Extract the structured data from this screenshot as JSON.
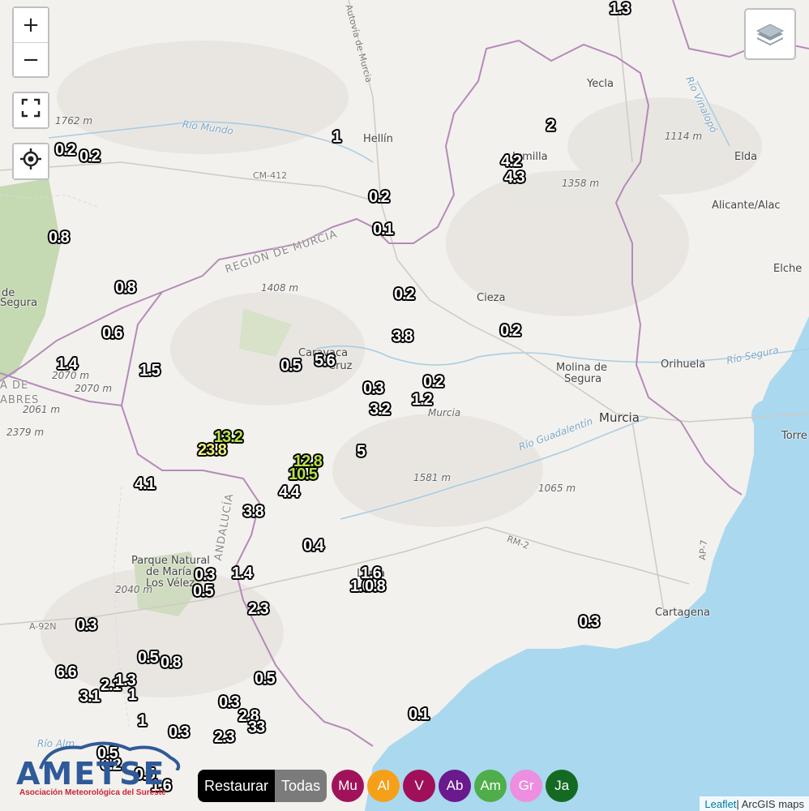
{
  "controls": {
    "zoom_in": "+",
    "zoom_out": "−"
  },
  "colors": {
    "sea": "#a9d7ef",
    "land": "#f2f0ec",
    "border": "#b58ab8",
    "green": "#c8d9b5",
    "logo": "#2f5a9a"
  },
  "places": [
    {
      "id": "hellin",
      "text": "Hellín",
      "cls": ""
    },
    {
      "id": "yecla",
      "text": "Yecla",
      "cls": ""
    },
    {
      "id": "jumilla",
      "text": "Jumilla",
      "cls": ""
    },
    {
      "id": "elda",
      "text": "Elda",
      "cls": ""
    },
    {
      "id": "alicante",
      "text": "Alicante/Alac",
      "cls": ""
    },
    {
      "id": "elche",
      "text": "Elche",
      "cls": ""
    },
    {
      "id": "cieza",
      "text": "Cieza",
      "cls": ""
    },
    {
      "id": "molina",
      "text": "Molina de",
      "cls": ""
    },
    {
      "id": "molina2",
      "text": "Segura",
      "cls": ""
    },
    {
      "id": "orihuela",
      "text": "Orihuela",
      "cls": ""
    },
    {
      "id": "murcia",
      "text": "Murcia",
      "cls": "big"
    },
    {
      "id": "murcia2",
      "text": "Murcia",
      "cls": "small"
    },
    {
      "id": "caravaca",
      "text": "Caravaca",
      "cls": ""
    },
    {
      "id": "cruz",
      "text": "Cruz",
      "cls": ""
    },
    {
      "id": "torre",
      "text": "Torre",
      "cls": ""
    },
    {
      "id": "cartagena",
      "text": "Cartagena",
      "cls": ""
    },
    {
      "id": "lorca",
      "text": "Lorca",
      "cls": ""
    },
    {
      "id": "parque1",
      "text": "Parque Natural",
      "cls": ""
    },
    {
      "id": "parque2",
      "text": "de María",
      "cls": ""
    },
    {
      "id": "parque3",
      "text": "Los Vélez",
      "cls": ""
    },
    {
      "id": "segura1",
      "text": "de",
      "cls": ""
    },
    {
      "id": "segura2",
      "text": "Segura",
      "cls": ""
    },
    {
      "id": "sierra1",
      "text": "A DE",
      "cls": "region"
    },
    {
      "id": "sierra2",
      "text": "ABRES",
      "cls": "region"
    },
    {
      "id": "region",
      "text": "REGIÓN DE MURCIA",
      "cls": "region"
    },
    {
      "id": "andalucia",
      "text": "ANDALUCÍA",
      "cls": "region"
    },
    {
      "id": "e1762",
      "text": "1762 m",
      "cls": "small"
    },
    {
      "id": "e1408",
      "text": "1408 m",
      "cls": "small"
    },
    {
      "id": "e1358",
      "text": "1358 m",
      "cls": "small"
    },
    {
      "id": "e1114",
      "text": "1114 m",
      "cls": "small"
    },
    {
      "id": "e2070a",
      "text": "2070 m",
      "cls": "small"
    },
    {
      "id": "e2070b",
      "text": "2070 m",
      "cls": "small"
    },
    {
      "id": "e2061",
      "text": "2061 m",
      "cls": "small"
    },
    {
      "id": "e2379",
      "text": "2379 m",
      "cls": "small"
    },
    {
      "id": "e1581",
      "text": "1581 m",
      "cls": "small"
    },
    {
      "id": "e1065",
      "text": "1065 m",
      "cls": "small"
    },
    {
      "id": "e2040",
      "text": "2040 m",
      "cls": "small"
    },
    {
      "id": "cm412",
      "text": "CM-412",
      "cls": "road"
    },
    {
      "id": "rm2",
      "text": "RM-2",
      "cls": "road"
    },
    {
      "id": "a92n",
      "text": "A-92N",
      "cls": "road"
    },
    {
      "id": "ap7",
      "text": "AP-7",
      "cls": "road"
    },
    {
      "id": "autovia",
      "text": "Autovía de Murcia",
      "cls": "road"
    },
    {
      "id": "mundo",
      "text": "Río Mundo",
      "cls": "water"
    },
    {
      "id": "vinalopo",
      "text": "Río Vinalopó",
      "cls": "water"
    },
    {
      "id": "rsegura",
      "text": "Río Segura",
      "cls": "water"
    },
    {
      "id": "guadalentin",
      "text": "Río Guadalentín",
      "cls": "water"
    },
    {
      "id": "rioalm",
      "text": "Río Alm",
      "cls": "water"
    }
  ],
  "values": [
    {
      "v": "1.3",
      "c": "low"
    },
    {
      "v": "2",
      "c": "low"
    },
    {
      "v": "1",
      "c": "low"
    },
    {
      "v": "0.2",
      "c": "low"
    },
    {
      "v": "0.2",
      "c": "low"
    },
    {
      "v": "4.2",
      "c": "low"
    },
    {
      "v": "4.3",
      "c": "low"
    },
    {
      "v": "0.2",
      "c": "low"
    },
    {
      "v": "0.1",
      "c": "low"
    },
    {
      "v": "0.8",
      "c": "low"
    },
    {
      "v": "0.8",
      "c": "low"
    },
    {
      "v": "0.2",
      "c": "low"
    },
    {
      "v": "0.6",
      "c": "low"
    },
    {
      "v": "3.8",
      "c": "low"
    },
    {
      "v": "0.2",
      "c": "low"
    },
    {
      "v": "1.4",
      "c": "low"
    },
    {
      "v": "1.5",
      "c": "low"
    },
    {
      "v": "0.5",
      "c": "low"
    },
    {
      "v": "5.6",
      "c": "low"
    },
    {
      "v": "0.3",
      "c": "low"
    },
    {
      "v": "0.2",
      "c": "low"
    },
    {
      "v": "1.2",
      "c": "low"
    },
    {
      "v": "3.2",
      "c": "low"
    },
    {
      "v": "13.2",
      "c": "mid"
    },
    {
      "v": "23.8",
      "c": "hi"
    },
    {
      "v": "5",
      "c": "low"
    },
    {
      "v": "12.8",
      "c": "mid"
    },
    {
      "v": "10.5",
      "c": "mid"
    },
    {
      "v": "4.1",
      "c": "low"
    },
    {
      "v": "4.4",
      "c": "low"
    },
    {
      "v": "3.8",
      "c": "low"
    },
    {
      "v": "0.4",
      "c": "low"
    },
    {
      "v": "1.6",
      "c": "low"
    },
    {
      "v": "1.0",
      "c": "low"
    },
    {
      "v": "0.8",
      "c": "low"
    },
    {
      "v": "0.3",
      "c": "low"
    },
    {
      "v": "1.4",
      "c": "low"
    },
    {
      "v": "0.5",
      "c": "low"
    },
    {
      "v": "2.3",
      "c": "low"
    },
    {
      "v": "0.3",
      "c": "low"
    },
    {
      "v": "0.3",
      "c": "low"
    },
    {
      "v": "0.5",
      "c": "low"
    },
    {
      "v": "0.8",
      "c": "low"
    },
    {
      "v": "6.6",
      "c": "low"
    },
    {
      "v": "2.1",
      "c": "low"
    },
    {
      "v": "1.3",
      "c": "low"
    },
    {
      "v": "3.1",
      "c": "low"
    },
    {
      "v": "1",
      "c": "low"
    },
    {
      "v": "0.5",
      "c": "low"
    },
    {
      "v": "0.3",
      "c": "low"
    },
    {
      "v": "2.8",
      "c": "low"
    },
    {
      "v": "0.1",
      "c": "low"
    },
    {
      "v": "1",
      "c": "low"
    },
    {
      "v": "0.3",
      "c": "low"
    },
    {
      "v": "33",
      "c": "low"
    },
    {
      "v": "2.3",
      "c": "low"
    },
    {
      "v": "0.2",
      "c": "low"
    },
    {
      "v": "0.5",
      "c": "low"
    },
    {
      "v": "0.5",
      "c": "low"
    },
    {
      "v": "1.6",
      "c": "low"
    }
  ],
  "logo": {
    "text": "AMETSE",
    "sub": "Asociación Meteorológica del Sureste"
  },
  "filters": {
    "restaurar": "Restaurar",
    "todas": "Todas",
    "provinces": [
      {
        "label": "Mu",
        "color": "#a0135a"
      },
      {
        "label": "Al",
        "color": "#f6a01a"
      },
      {
        "label": "V",
        "color": "#a0105a"
      },
      {
        "label": "Ab",
        "color": "#6a1a8c"
      },
      {
        "label": "Am",
        "color": "#4fae4a"
      },
      {
        "label": "Gr",
        "color": "#ee8ee0"
      },
      {
        "label": "Ja",
        "color": "#146a22"
      }
    ]
  },
  "attribution": {
    "leaflet": "Leaflet",
    "rest": " | ArcGIS maps"
  }
}
